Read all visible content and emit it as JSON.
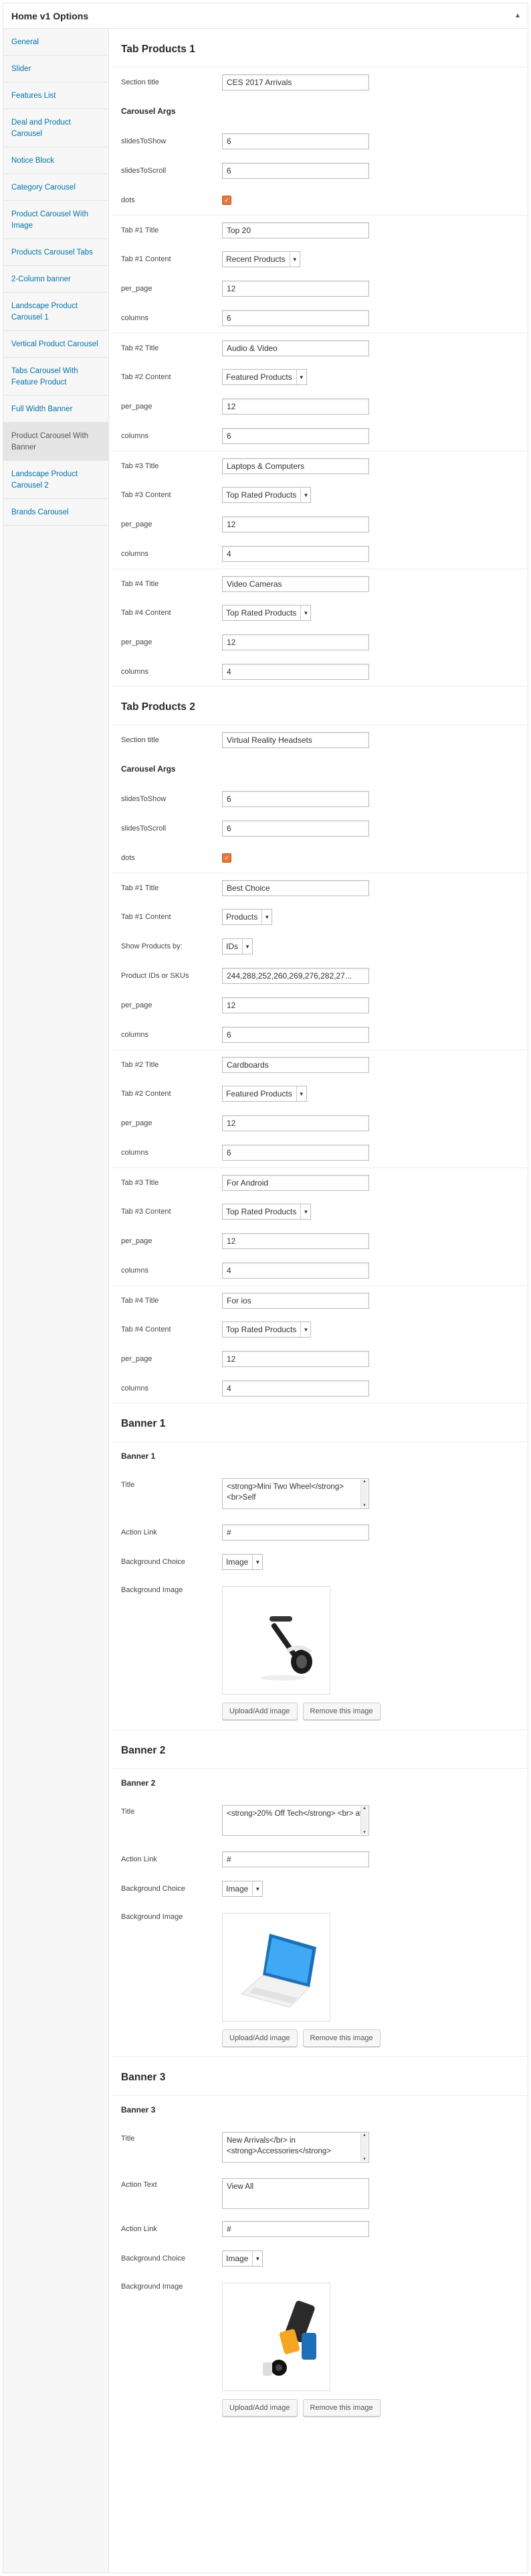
{
  "panel": {
    "title": "Home v1 Options",
    "toggle": "▲"
  },
  "sidebar": {
    "items": [
      {
        "label": "General"
      },
      {
        "label": "Slider"
      },
      {
        "label": "Features List"
      },
      {
        "label": "Deal and Product Carousel"
      },
      {
        "label": "Notice Block"
      },
      {
        "label": "Category Carousel"
      },
      {
        "label": "Product Carousel With Image"
      },
      {
        "label": "Products Carousel Tabs"
      },
      {
        "label": "2-Column banner"
      },
      {
        "label": "Landscape Product Carousel 1"
      },
      {
        "label": "Vertical Product Carousel"
      },
      {
        "label": "Tabs Carousel With Feature Product"
      },
      {
        "label": "Full Width Banner"
      },
      {
        "label": "Product Carousel With Banner",
        "active": true
      },
      {
        "label": "Landscape Product Carousel 2"
      },
      {
        "label": "Brands Carousel"
      }
    ]
  },
  "tp1": {
    "title": "Tab Products 1",
    "section_title_label": "Section title",
    "section_title_value": "CES 2017 Arrivals",
    "carousel_args": "Carousel Args",
    "slides_show_label": "slidesToShow",
    "slides_show_value": "6",
    "slides_scroll_label": "slidesToScroll",
    "slides_scroll_value": "6",
    "dots_label": "dots",
    "tabs": [
      {
        "title_label": "Tab #1 Title",
        "title_value": "Top 20",
        "content_label": "Tab #1 Content",
        "content_value": "Recent Products",
        "per_page_label": "per_page",
        "per_page_value": "12",
        "columns_label": "columns",
        "columns_value": "6"
      },
      {
        "title_label": "Tab #2 Title",
        "title_value": "Audio & Video",
        "content_label": "Tab #2 Content",
        "content_value": "Featured Products",
        "per_page_label": "per_page",
        "per_page_value": "12",
        "columns_label": "columns",
        "columns_value": "6"
      },
      {
        "title_label": "Tab #3 Title",
        "title_value": "Laptops & Computers",
        "content_label": "Tab #3 Content",
        "content_value": "Top Rated Products",
        "per_page_label": "per_page",
        "per_page_value": "12",
        "columns_label": "columns",
        "columns_value": "4"
      },
      {
        "title_label": "Tab #4 Title",
        "title_value": "Video Cameras",
        "content_label": "Tab #4 Content",
        "content_value": "Top Rated Products",
        "per_page_label": "per_page",
        "per_page_value": "12",
        "columns_label": "columns",
        "columns_value": "4"
      }
    ]
  },
  "tp2": {
    "title": "Tab Products 2",
    "section_title_label": "Section title",
    "section_title_value": "Virtual Reality Headsets",
    "carousel_args": "Carousel Args",
    "slides_show_label": "slidesToShow",
    "slides_show_value": "6",
    "slides_scroll_label": "slidesToScroll",
    "slides_scroll_value": "6",
    "dots_label": "dots",
    "tab1": {
      "title_label": "Tab #1 Title",
      "title_value": "Best Choice",
      "content_label": "Tab #1 Content",
      "content_value": "Products",
      "show_by_label": "Show Products by:",
      "show_by_value": "IDs",
      "ids_label": "Product IDs or SKUs",
      "ids_value": "244,288,252,260,269,276,282,27...",
      "per_page_label": "per_page",
      "per_page_value": "12",
      "columns_label": "columns",
      "columns_value": "6"
    },
    "tabs": [
      {
        "title_label": "Tab #2 Title",
        "title_value": "Cardboards",
        "content_label": "Tab #2 Content",
        "content_value": "Featured Products",
        "per_page_label": "per_page",
        "per_page_value": "12",
        "columns_label": "columns",
        "columns_value": "6"
      },
      {
        "title_label": "Tab #3 Title",
        "title_value": "For Android",
        "content_label": "Tab #3 Content",
        "content_value": "Top Rated Products",
        "per_page_label": "per_page",
        "per_page_value": "12",
        "columns_label": "columns",
        "columns_value": "4"
      },
      {
        "title_label": "Tab #4 Title",
        "title_value": "For ios",
        "content_label": "Tab #4 Content",
        "content_value": "Top Rated Products",
        "per_page_label": "per_page",
        "per_page_value": "12",
        "columns_label": "columns",
        "columns_value": "4"
      }
    ]
  },
  "banner1": {
    "title": "Banner 1",
    "sub": "Banner 1",
    "title_label": "Title",
    "title_value": "<strong>Mini Two Wheel</strong> <br>Self",
    "link_label": "Action Link",
    "link_value": "#",
    "bg_label": "Background Choice",
    "bg_value": "Image",
    "img_label": "Background Image",
    "upload": "Upload/Add image",
    "remove": "Remove this image"
  },
  "banner2": {
    "title": "Banner 2",
    "sub": "Banner 2",
    "title_label": "Title",
    "title_value": "<strong>20% Off Tech</strong> <br> at",
    "link_label": "Action Link",
    "link_value": "#",
    "bg_label": "Background Choice",
    "bg_value": "Image",
    "img_label": "Background Image",
    "upload": "Upload/Add image",
    "remove": "Remove this image"
  },
  "banner3": {
    "title": "Banner 3",
    "sub": "Banner 3",
    "title_label": "Title",
    "title_value": "New Arrivals</br> in <strong>Accessories</strong>",
    "action_text_label": "Action Text",
    "action_text_value": "View All",
    "link_label": "Action Link",
    "link_value": "#",
    "bg_label": "Background Choice",
    "bg_value": "Image",
    "img_label": "Background Image",
    "upload": "Upload/Add image",
    "remove": "Remove this image"
  }
}
